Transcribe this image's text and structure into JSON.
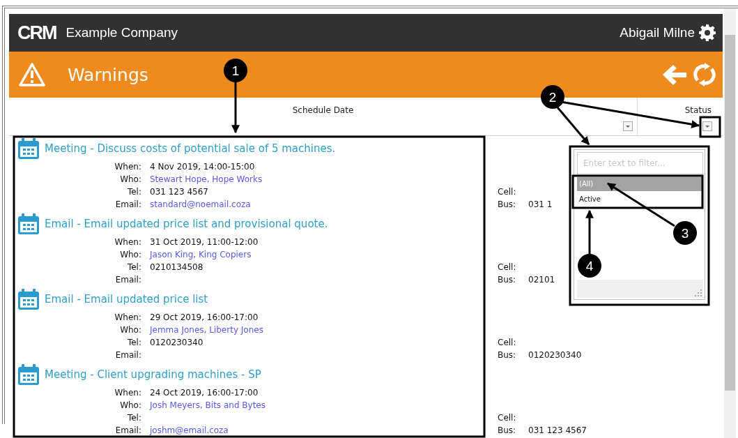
{
  "header": {
    "logo": "CRM",
    "company": "Example Company",
    "user": "Abigail Milne"
  },
  "page": {
    "title": "Warnings"
  },
  "columns": [
    {
      "label": "Schedule Date"
    },
    {
      "label": "Status"
    }
  ],
  "records": [
    {
      "title": "Meeting - Discuss costs of potential sale of 5 machines.",
      "fields": [
        {
          "label": "When:",
          "value": "4 Nov 2019, 14:00-15:00",
          "link": false
        },
        {
          "label": "Who:",
          "value": "Stewart Hope, Hope Works",
          "link": true
        },
        {
          "label": "Tel:",
          "value": "031 123 4567",
          "link": false
        },
        {
          "label": "Email:",
          "value": "standard@noemail.coza",
          "link": true
        }
      ],
      "side": [
        {
          "label": "Cell:"
        },
        {
          "label": "Bus:",
          "value": "031 1"
        }
      ]
    },
    {
      "title": "Email - Email updated price list and provisional quote.",
      "fields": [
        {
          "label": "When:",
          "value": "31 Oct 2019, 11:00-12:00",
          "link": false
        },
        {
          "label": "Who:",
          "value": "Jason King, King Copiers",
          "link": true
        },
        {
          "label": "Tel:",
          "value": "0210134508",
          "link": false
        },
        {
          "label": "Email:"
        }
      ],
      "side": [
        {
          "label": "Cell:"
        },
        {
          "label": "Bus:",
          "value": "02101"
        }
      ]
    },
    {
      "title": "Email - Email updated price list",
      "fields": [
        {
          "label": "When:",
          "value": "29 Oct 2019, 16:00-17:00",
          "link": false
        },
        {
          "label": "Who:",
          "value": "Jemma Jones, Liberty Jones",
          "link": true
        },
        {
          "label": "Tel:",
          "value": "0120230340",
          "link": false
        },
        {
          "label": "Email:"
        }
      ],
      "side": [
        {
          "label": "Cell:"
        },
        {
          "label": "Bus:",
          "value": "0120230340"
        }
      ]
    },
    {
      "title": "Meeting - Client upgrading machines - SP",
      "fields": [
        {
          "label": "When:",
          "value": "24 Oct 2019, 16:00-17:00",
          "link": false
        },
        {
          "label": "Who:",
          "value": "Josh Meyers, Bits and Bytes",
          "link": true
        },
        {
          "label": "Tel:"
        },
        {
          "label": "Email:",
          "value": "joshm@email.coza",
          "link": true
        }
      ],
      "side": [
        {
          "label": "Cell:"
        },
        {
          "label": "Bus:",
          "value": "031 123 4567"
        }
      ]
    }
  ],
  "filter_dropdown": {
    "placeholder": "Enter text to filter...",
    "options": [
      {
        "label": "(All)",
        "selected": true
      },
      {
        "label": "Active",
        "selected": false
      }
    ]
  },
  "callouts": [
    {
      "number": "1"
    },
    {
      "number": "2"
    },
    {
      "number": "3"
    },
    {
      "number": "4"
    }
  ]
}
